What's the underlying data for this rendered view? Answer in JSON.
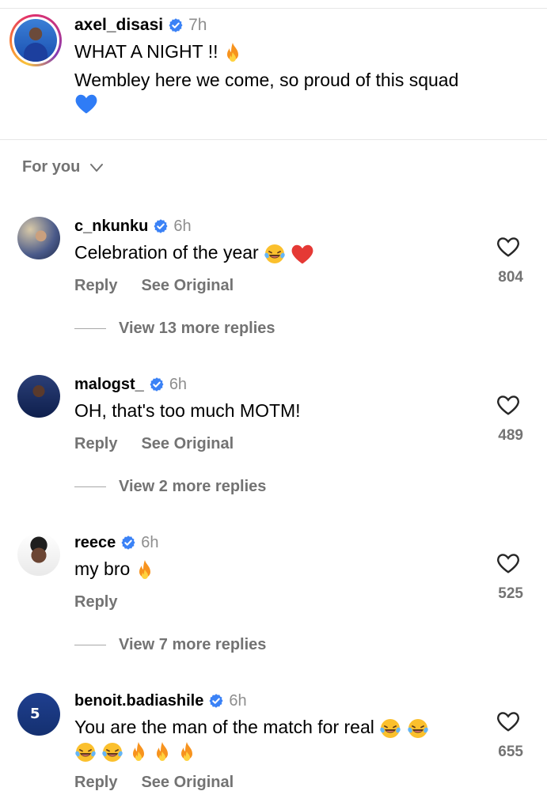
{
  "post": {
    "username": "axel_disasi",
    "time": "7h",
    "line1": "WHAT A NIGHT !!",
    "line2": "Wembley here we come, so proud of this squad"
  },
  "sort": {
    "label": "For you"
  },
  "comments": [
    {
      "username": "c_nkunku",
      "time": "6h",
      "text": "Celebration of the year",
      "reply_label": "Reply",
      "see_original_label": "See Original",
      "likes": "804",
      "view_replies": "View 13 more replies"
    },
    {
      "username": "malogst_",
      "time": "6h",
      "text": "OH, that's too much MOTM!",
      "reply_label": "Reply",
      "see_original_label": "See Original",
      "likes": "489",
      "view_replies": "View 2 more replies"
    },
    {
      "username": "reece",
      "time": "6h",
      "text": "my bro",
      "reply_label": "Reply",
      "likes": "525",
      "view_replies": "View 7 more replies"
    },
    {
      "username": "benoit.badiashile",
      "time": "6h",
      "text": "You are the man of the match for real",
      "reply_label": "Reply",
      "see_original_label": "See Original",
      "likes": "655"
    }
  ],
  "colors": {
    "verified": "#1d9bf0",
    "secondary_text": "#737373",
    "heart_blue": "#2f7cf6"
  }
}
